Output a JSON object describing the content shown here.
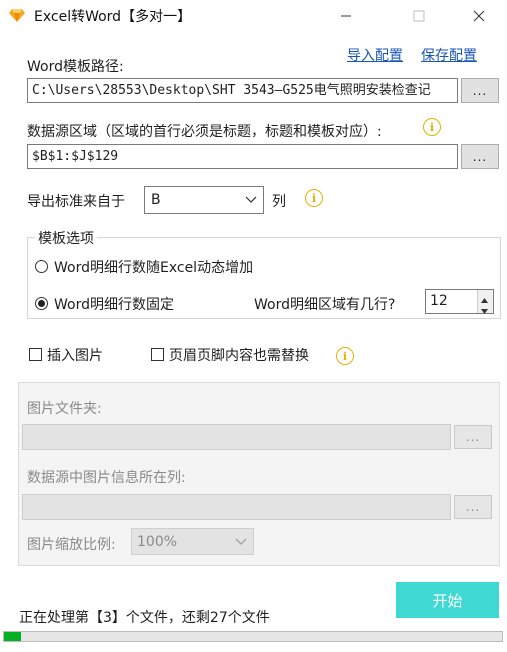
{
  "window": {
    "title": "Excel转Word【多对一】",
    "minimize_icon": "minimize-icon",
    "maximize_icon": "maximize-icon",
    "close_icon": "close-icon",
    "app_icon": "diamond-icon"
  },
  "links": {
    "import_config": "导入配置",
    "save_config": "保存配置"
  },
  "template": {
    "label": "Word模板路径:",
    "value": "C:\\Users\\28553\\Desktop\\SHT 3543—G525电气照明安装检查记",
    "browse": "..."
  },
  "datasource": {
    "label": "数据源区域（区域的首行必须是标题，标题和模板对应）:",
    "value": "$B$1:$J$129",
    "browse": "..."
  },
  "export_standard": {
    "label": "导出标准来自于",
    "selected": "B",
    "suffix": "列"
  },
  "template_options": {
    "title": "模板选项",
    "option_dynamic": "Word明细行数随Excel动态增加",
    "option_fixed": "Word明细行数固定",
    "selected": "fixed",
    "rows_label": "Word明细区域有几行?",
    "rows_value": "12"
  },
  "checkboxes": {
    "insert_image": "插入图片",
    "insert_image_checked": false,
    "replace_header_footer": "页眉页脚内容也需替换",
    "replace_header_footer_checked": false
  },
  "image_panel": {
    "folder_label": "图片文件夹:",
    "folder_value": "",
    "folder_browse": "...",
    "column_label": "数据源中图片信息所在列:",
    "column_value": "",
    "column_browse": "...",
    "scale_label": "图片缩放比例:",
    "scale_value": "100%"
  },
  "actions": {
    "start": "开始"
  },
  "status": {
    "text": "正在处理第【3】个文件，还剩27个文件",
    "progress": 0.035
  },
  "colors": {
    "accent": "#3fd8d2",
    "link": "#1a56b8",
    "info": "#e8b200",
    "progress": "#06b025"
  }
}
